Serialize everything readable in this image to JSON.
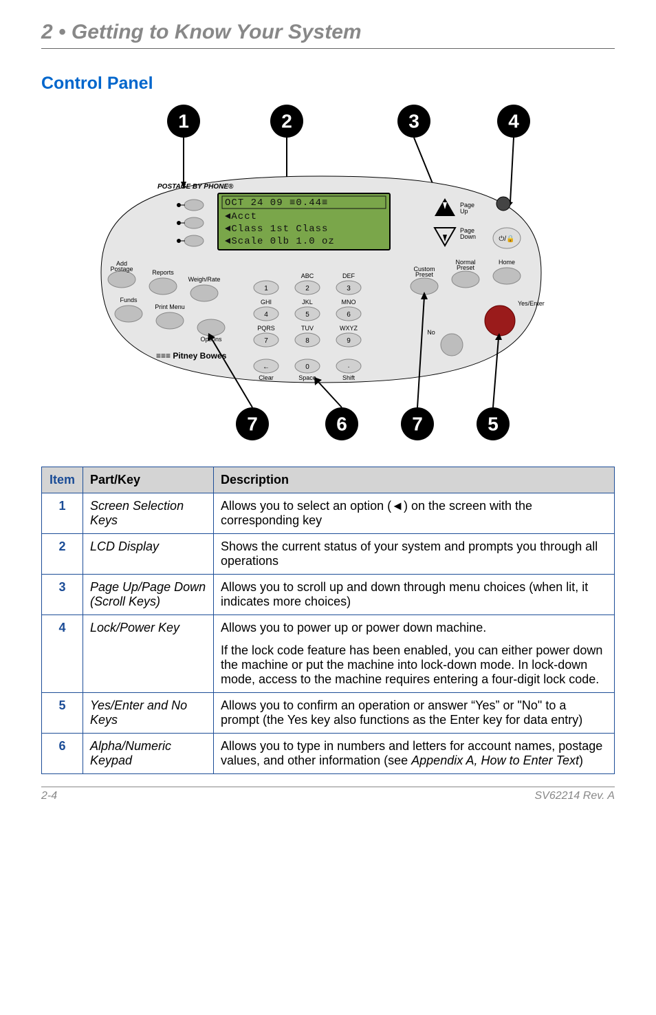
{
  "chapter_title": "2 • Getting to Know Your System",
  "section_title": "Control Panel",
  "screen": {
    "line1": "OCT 24 09  ≡0.44≡",
    "line2": "◄Acct",
    "line3": "◄Class 1st Class",
    "line4": "◄Scale 0lb 1.0 oz"
  },
  "panel_labels": {
    "brand_top": "POSTAGE BY PHONE®",
    "page_up": "Page Up",
    "page_down": "Page Down",
    "add_postage": "Add Postage",
    "reports": "Reports",
    "weigh_rate": "Weigh/Rate",
    "funds": "Funds",
    "print_menu": "Print Menu",
    "options": "Options",
    "custom_preset": "Custom Preset",
    "normal_preset": "Normal Preset",
    "home": "Home",
    "yes_enter": "Yes/Enter",
    "no": "No",
    "brand_bottom": "Pitney Bowes",
    "clear": "Clear",
    "space": "Space",
    "shift": "Shift",
    "keypad": {
      "k1": "1",
      "k2": "2",
      "abc": "ABC",
      "k3": "3",
      "def": "DEF",
      "k4": "4",
      "ghi": "GHI",
      "k5": "5",
      "jkl": "JKL",
      "k6": "6",
      "mno": "MNO",
      "k7": "7",
      "pqrs": "PQRS",
      "k8": "8",
      "tuv": "TUV",
      "k9": "9",
      "wxyz": "WXYZ",
      "k0": "0"
    }
  },
  "callouts": {
    "c1": "1",
    "c2": "2",
    "c3": "3",
    "c4": "4",
    "c5": "5",
    "c6": "6",
    "c7": "7"
  },
  "table": {
    "headers": {
      "item": "Item",
      "part": "Part/Key",
      "desc": "Description"
    },
    "rows": [
      {
        "item": "1",
        "part": "Screen Selection Keys",
        "desc": "Allows you to select an option (◄) on the screen with the corresponding key"
      },
      {
        "item": "2",
        "part": "LCD Display",
        "desc": "Shows the current status of your system and prompts you through all operations"
      },
      {
        "item": "3",
        "part": "Page Up/Page Down (Scroll Keys)",
        "desc": "Allows you to scroll up and down through menu choices (when lit, it indicates more choices)"
      },
      {
        "item": "4",
        "part": "Lock/Power Key",
        "desc": "Allows you to power up or power down machine.",
        "desc2": "If the lock code feature has been enabled, you can either power down the machine or put the machine into lock-down mode. In lock-down mode, access to the machine requires entering a four-digit lock code."
      },
      {
        "item": "5",
        "part": "Yes/Enter and No Keys",
        "desc": "Allows you to confirm an operation or answer “Yes” or \"No\" to  a prompt (the Yes key also functions as the Enter key for data entry)"
      },
      {
        "item": "6",
        "part": "Alpha/Numeric Keypad",
        "desc_prefix": "Allows you to type in numbers and letters for account names, postage values, and other information (see ",
        "desc_ital": "Appendix A, How to Enter Text",
        "desc_suffix": ")"
      }
    ]
  },
  "footer": {
    "left": "2-4",
    "right": "SV62214 Rev. A"
  }
}
